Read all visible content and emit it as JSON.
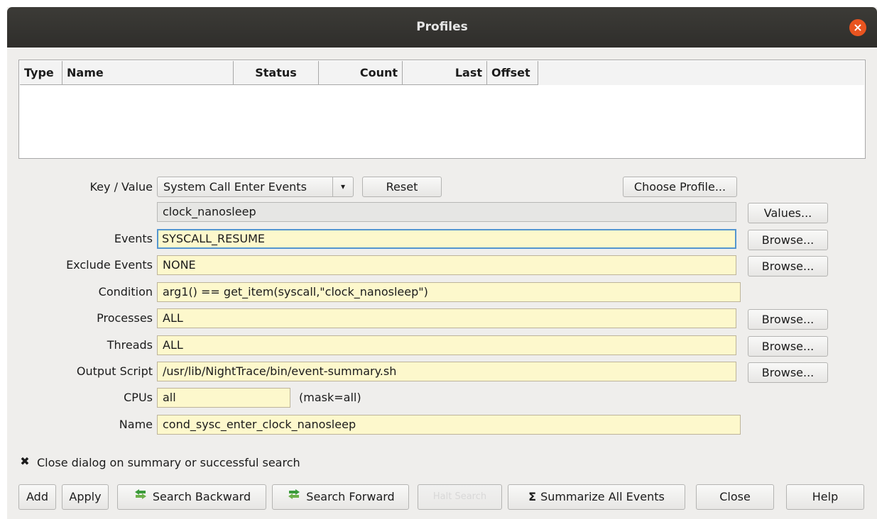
{
  "window": {
    "title": "Profiles"
  },
  "table": {
    "columns": [
      "Type",
      "Name",
      "Status",
      "Count",
      "Last",
      "Offset"
    ]
  },
  "form": {
    "key_value_label": "Key / Value",
    "key_value_selected": "System Call Enter Events",
    "reset_label": "Reset",
    "choose_profile_label": "Choose Profile...",
    "value_field": "clock_nanosleep",
    "values_button": "Values...",
    "events_label": "Events",
    "events_value": "SYSCALL_RESUME",
    "exclude_label": "Exclude Events",
    "exclude_value": "NONE",
    "condition_label": "Condition",
    "condition_value": "arg1() == get_item(syscall,\"clock_nanosleep\")",
    "processes_label": "Processes",
    "processes_value": "ALL",
    "threads_label": "Threads",
    "threads_value": "ALL",
    "output_label": "Output Script",
    "output_value": "/usr/lib/NightTrace/bin/event-summary.sh",
    "cpus_label": "CPUs",
    "cpus_value": "all",
    "mask_text": "(mask=all)",
    "name_label": "Name",
    "name_value": "cond_sysc_enter_clock_nanosleep",
    "browse_label": "Browse..."
  },
  "option": {
    "checkbox_mark": "✖",
    "label": "Close dialog on summary or successful search"
  },
  "buttons": {
    "add": "Add",
    "apply": "Apply",
    "search_backward": "Search Backward",
    "search_forward": "Search Forward",
    "halt_search": "Halt Search",
    "summarize_symbol": "Σ",
    "summarize": "Summarize All Events",
    "close": "Close",
    "help": "Help"
  },
  "colors": {
    "title_bg": "#3c3b37",
    "close_accent": "#e95420",
    "field_bg": "#fdf8cc",
    "focus_border": "#5596cf"
  },
  "icons": {
    "window_close": "×",
    "combo_arrow": "▾"
  }
}
